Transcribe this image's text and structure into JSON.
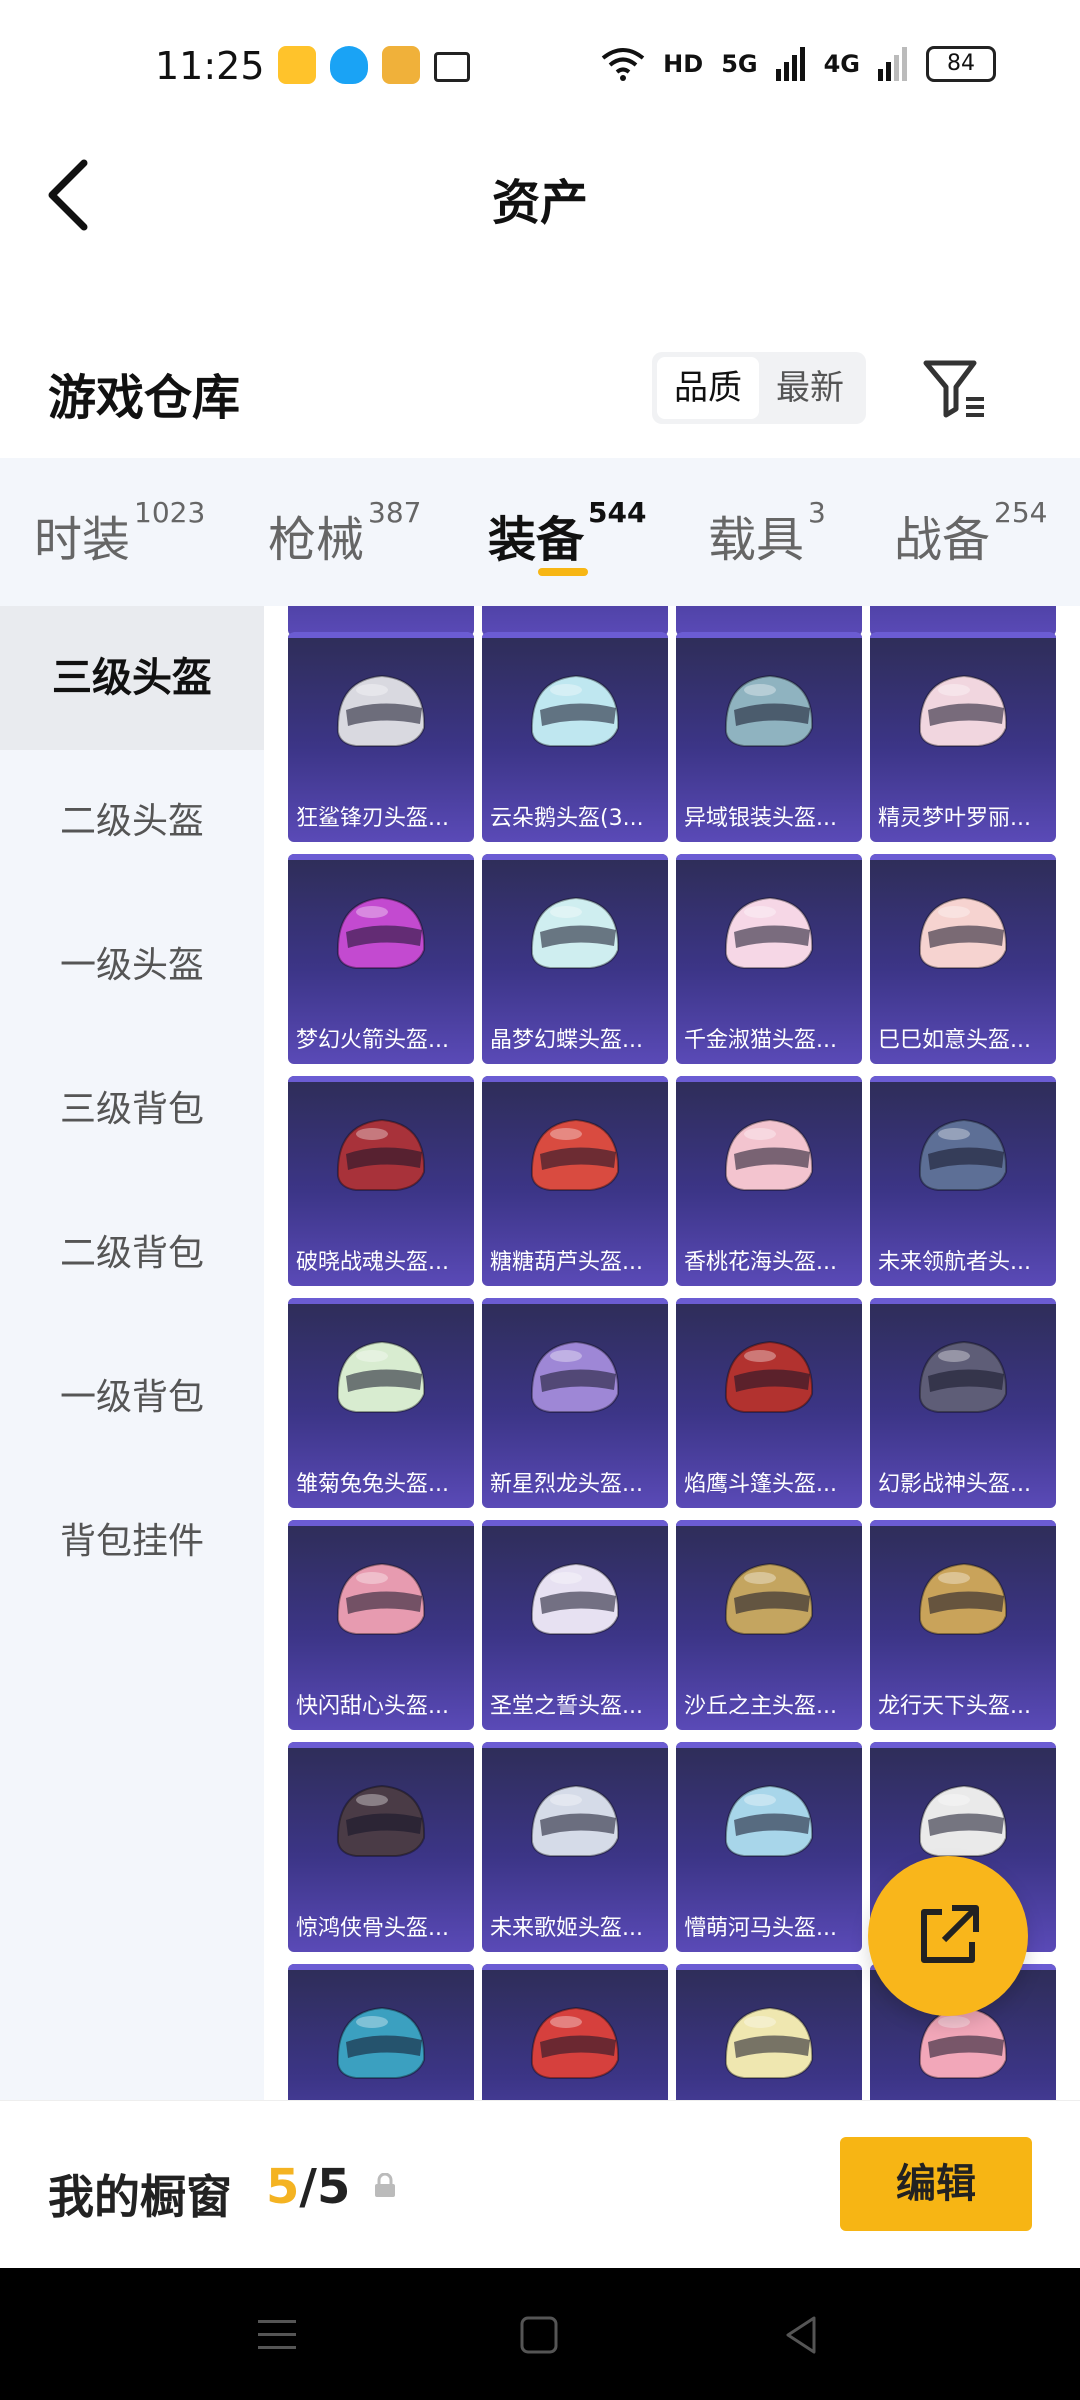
{
  "status_bar": {
    "time": "11:25",
    "network_5g": "5G",
    "network_4g": "4G",
    "hd": "HD",
    "battery": "84"
  },
  "header": {
    "title": "资产"
  },
  "section": {
    "title": "游戏仓库",
    "sort": {
      "quality": "品质",
      "latest": "最新"
    }
  },
  "tabs": [
    {
      "label": "时装",
      "count": "1023"
    },
    {
      "label": "枪械",
      "count": "387"
    },
    {
      "label": "装备",
      "count": "544"
    },
    {
      "label": "载具",
      "count": "3"
    },
    {
      "label": "战备",
      "count": "254"
    }
  ],
  "sidebar": {
    "items": [
      "三级头盔",
      "二级头盔",
      "一级头盔",
      "三级背包",
      "二级背包",
      "一级背包",
      "背包挂件"
    ]
  },
  "items": [
    {
      "name": "狂鲨锋刃头盔...",
      "color": "#d9d9e0"
    },
    {
      "name": "云朵鹅头盔(3...",
      "color": "#bfe7f0"
    },
    {
      "name": "异域银装头盔...",
      "color": "#8fb3c0"
    },
    {
      "name": "精灵梦叶罗丽...",
      "color": "#f1d6df"
    },
    {
      "name": "梦幻火箭头盔...",
      "color": "#c34ad0"
    },
    {
      "name": "晶梦幻蝶头盔...",
      "color": "#cfeef0"
    },
    {
      "name": "千金淑猫头盔...",
      "color": "#f6d7e6"
    },
    {
      "name": "巳巳如意头盔...",
      "color": "#f6d3d0"
    },
    {
      "name": "破晓战魂头盔...",
      "color": "#a8323a"
    },
    {
      "name": "糖糖葫芦头盔...",
      "color": "#d94b40"
    },
    {
      "name": "香桃花海头盔...",
      "color": "#f3c4cf"
    },
    {
      "name": "未来领航者头...",
      "color": "#5d6f96"
    },
    {
      "name": "雏菊兔兔头盔...",
      "color": "#d8ecd0"
    },
    {
      "name": "新星烈龙头盔...",
      "color": "#9e87d6"
    },
    {
      "name": "焰鹰斗篷头盔...",
      "color": "#b2322f"
    },
    {
      "name": "幻影战神头盔...",
      "color": "#5e5d77"
    },
    {
      "name": "快闪甜心头盔...",
      "color": "#e79bb0"
    },
    {
      "name": "圣堂之誓头盔...",
      "color": "#e7e1f2"
    },
    {
      "name": "沙丘之主头盔...",
      "color": "#c4a560"
    },
    {
      "name": "龙行天下头盔...",
      "color": "#c9a35a"
    },
    {
      "name": "惊鸿侠骨头盔...",
      "color": "#4a3b46"
    },
    {
      "name": "未来歌姬头盔...",
      "color": "#d5dbe8"
    },
    {
      "name": "懵萌河马头盔...",
      "color": "#a8d6ea"
    },
    {
      "name": "",
      "color": "#eaeaea"
    },
    {
      "name": "",
      "color": "#3ba0c0"
    },
    {
      "name": "",
      "color": "#d6403d"
    },
    {
      "name": "",
      "color": "#efe7b0"
    },
    {
      "name": "",
      "color": "#f2a7b9"
    }
  ],
  "bottom": {
    "showcase_label": "我的橱窗",
    "current": "5",
    "separator": "/",
    "total": "5",
    "edit_label": "编辑"
  },
  "colors": {
    "accent": "#f7b514",
    "card_bg": "#3c3587"
  }
}
